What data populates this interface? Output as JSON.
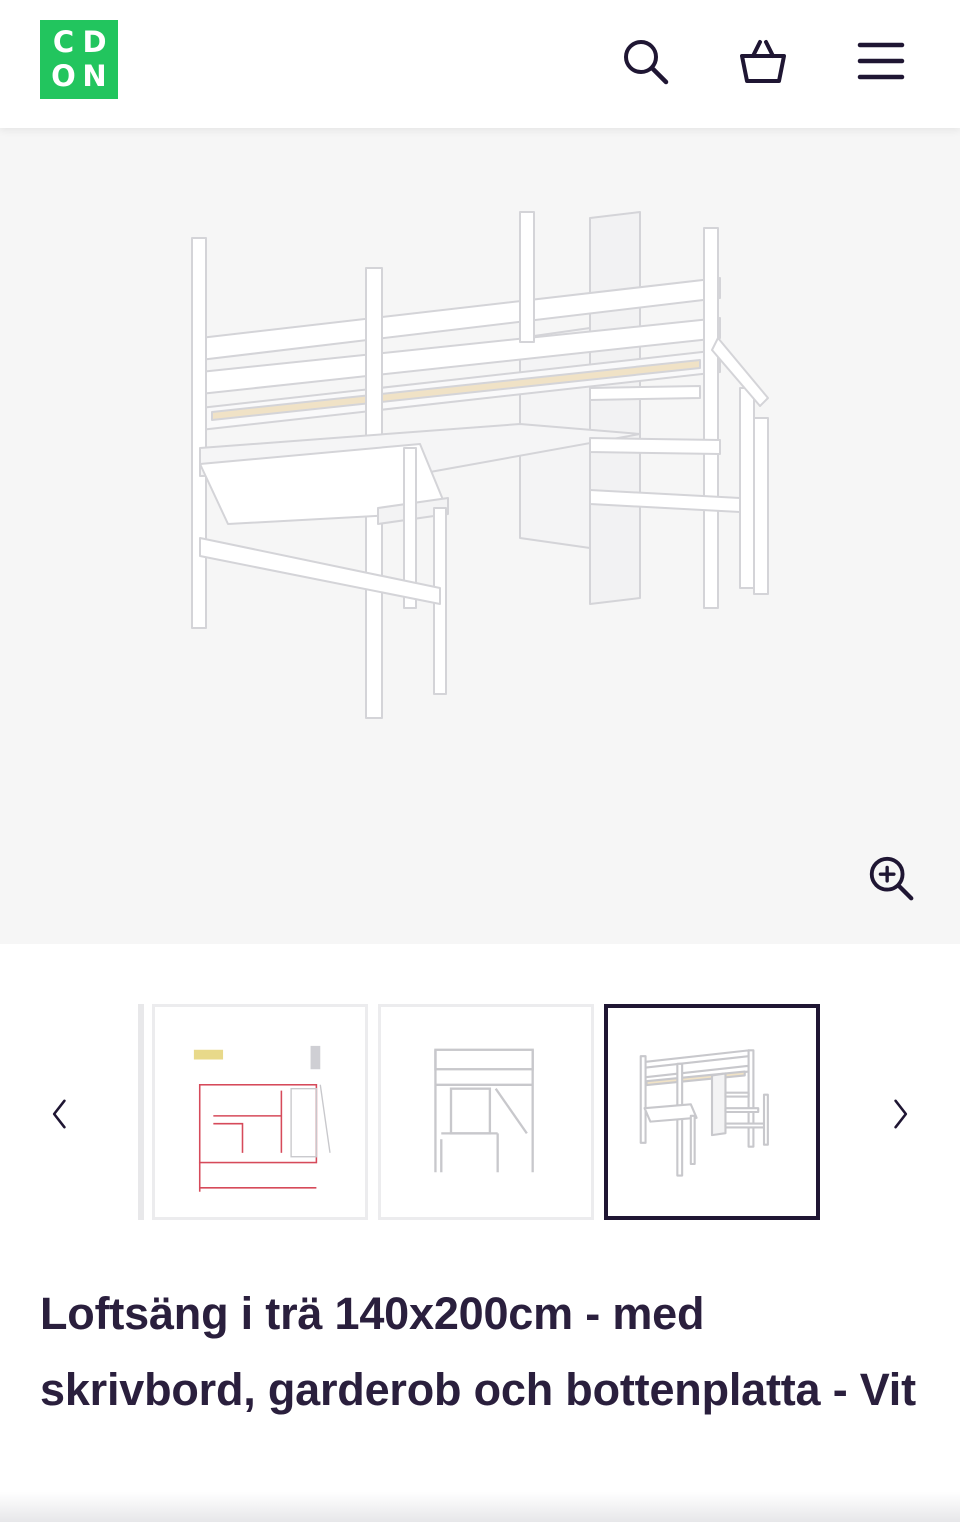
{
  "header": {
    "logo_letters": [
      "C",
      "D",
      "O",
      "N"
    ],
    "icons": [
      "search-icon",
      "basket-icon",
      "menu-icon"
    ]
  },
  "gallery": {
    "main_image": "white-loft-bed-with-desk-wardrobe-and-stairs",
    "zoom_icon": "zoom-in-icon",
    "prev_icon": "chevron-left-icon",
    "next_icon": "chevron-right-icon",
    "thumbnails": [
      {
        "image": "dimension-drawing",
        "active": false
      },
      {
        "image": "front-view",
        "active": false
      },
      {
        "image": "perspective-view",
        "active": true
      }
    ]
  },
  "product": {
    "title": "Loftsäng i trä 140x200cm - med skrivbord, garderob och bottenplatta - Vit"
  },
  "colors": {
    "brand_green": "#22c55e",
    "text_dark": "#2a1f3d",
    "active_border": "#1f1633",
    "hero_bg": "#f6f6f6"
  }
}
